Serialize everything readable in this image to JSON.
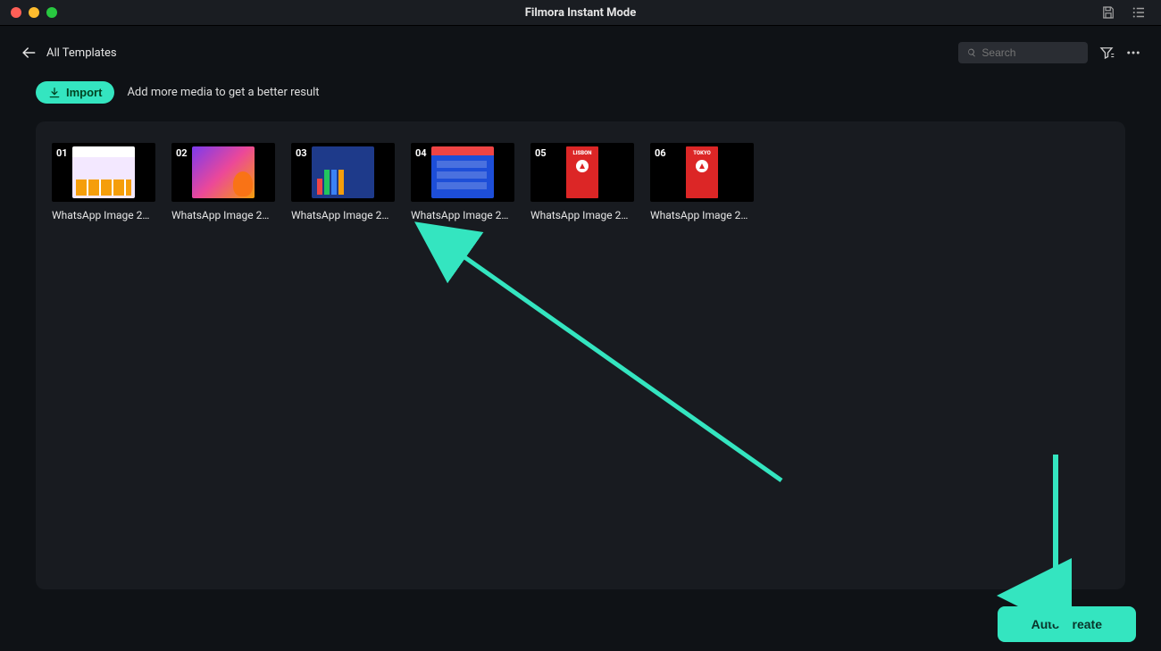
{
  "app_title": "Filmora Instant Mode",
  "back_label": "All Templates",
  "search_placeholder": "Search",
  "import_label": "Import",
  "hint_text": "Add more media to get a better result",
  "create_label": "Auto Create",
  "items": [
    {
      "badge": "01",
      "label": "WhatsApp Image 202…"
    },
    {
      "badge": "02",
      "label": "WhatsApp Image 202…"
    },
    {
      "badge": "03",
      "label": "WhatsApp Image 202…"
    },
    {
      "badge": "04",
      "label": "WhatsApp Image 202…"
    },
    {
      "badge": "05",
      "label": "WhatsApp Image 202…"
    },
    {
      "badge": "06",
      "label": "WhatsApp Image 202…"
    }
  ],
  "colors": {
    "accent": "#34e5c0"
  }
}
